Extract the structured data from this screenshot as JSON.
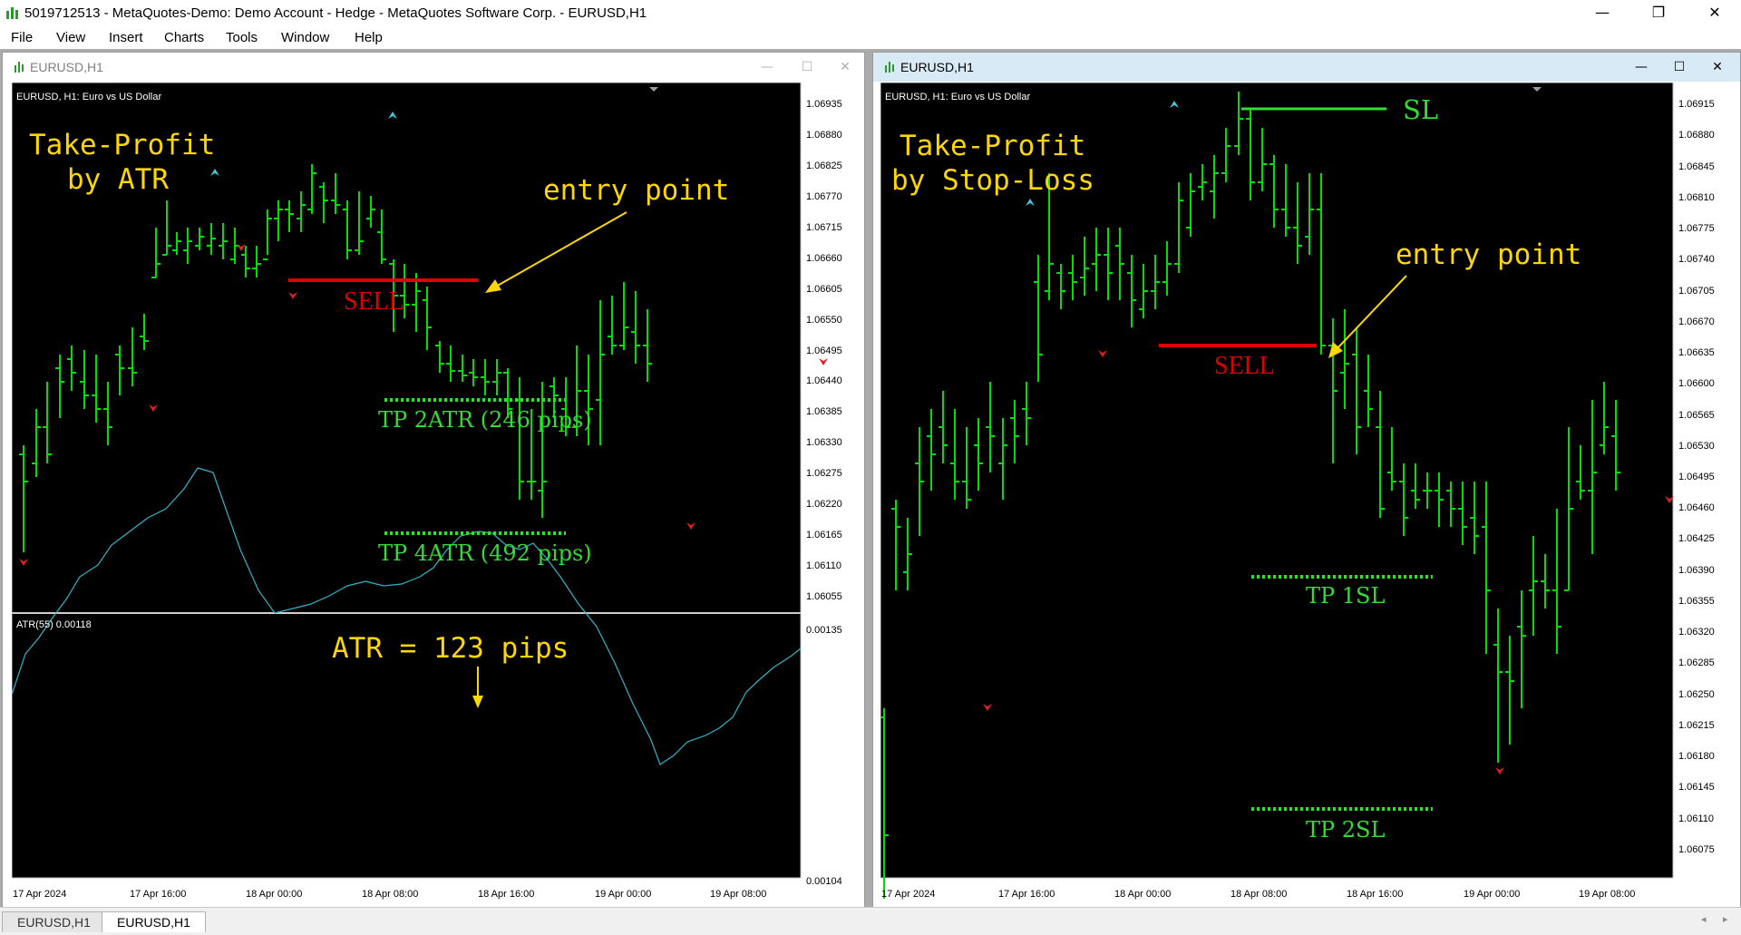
{
  "window": {
    "title": "5019712513 - MetaQuotes-Demo: Demo Account - Hedge - MetaQuotes Software Corp. - EURUSD,H1",
    "minimize": "—",
    "restore": "❐",
    "close": "✕"
  },
  "menu": [
    "File",
    "View",
    "Insert",
    "Charts",
    "Tools",
    "Window",
    "Help"
  ],
  "colors": {
    "chart_bg": "#000000",
    "bars": "#00e000",
    "sell": "#e00000",
    "annotation": "#ffd700",
    "tp": "#33dd33",
    "atr_line": "#2fb5c8"
  },
  "left_window": {
    "title": "EURUSD,H1",
    "info": "EURUSD, H1:  Euro vs US Dollar",
    "ann_title_1": "Take-Profit",
    "ann_title_2": "by ATR",
    "entry_label": "entry point",
    "sell_label": "SELL",
    "tp1_label": "TP  2ATR  (246  pips)",
    "tp2_label": "TP  4ATR  (492  pips)",
    "atr_info": "ATR(55) 0.00118",
    "atr_label": "ATR  =  123  pips",
    "price_ticks": [
      "1.06935",
      "1.06880",
      "1.06825",
      "1.06770",
      "1.06715",
      "1.06660",
      "1.06605",
      "1.06550",
      "1.06495",
      "1.06440",
      "1.06385",
      "1.06330",
      "1.06275",
      "1.06220",
      "1.06165",
      "1.06110",
      "1.06055"
    ],
    "atr_ticks": [
      "0.00135",
      "0.00104"
    ],
    "time_ticks": [
      "17 Apr 2024",
      "17 Apr 16:00",
      "18 Apr 00:00",
      "18 Apr 08:00",
      "18 Apr 16:00",
      "19 Apr 00:00",
      "19 Apr 08:00"
    ]
  },
  "right_window": {
    "title": "EURUSD,H1",
    "info": "EURUSD, H1:  Euro vs US Dollar",
    "ann_title_1": "Take-Profit",
    "ann_title_2": "by Stop-Loss",
    "sl_label": "SL",
    "entry_label": "entry point",
    "sell_label": "SELL",
    "tp1_label": "TP  1SL",
    "tp2_label": "TP  2SL",
    "price_ticks": [
      "1.06915",
      "1.06880",
      "1.06845",
      "1.06810",
      "1.06775",
      "1.06740",
      "1.06705",
      "1.06670",
      "1.06635",
      "1.06600",
      "1.06565",
      "1.06530",
      "1.06495",
      "1.06460",
      "1.06425",
      "1.06390",
      "1.06355",
      "1.06320",
      "1.06285",
      "1.06250",
      "1.06215",
      "1.06180",
      "1.06145",
      "1.06110",
      "1.06075"
    ],
    "time_ticks": [
      "17 Apr 2024",
      "17 Apr 16:00",
      "18 Apr 00:00",
      "18 Apr 08:00",
      "18 Apr 16:00",
      "19 Apr 00:00",
      "19 Apr 08:00"
    ]
  },
  "tabs": [
    "EURUSD,H1",
    "EURUSD,H1"
  ],
  "scroll": {
    "left": "◂",
    "right": "▸"
  }
}
